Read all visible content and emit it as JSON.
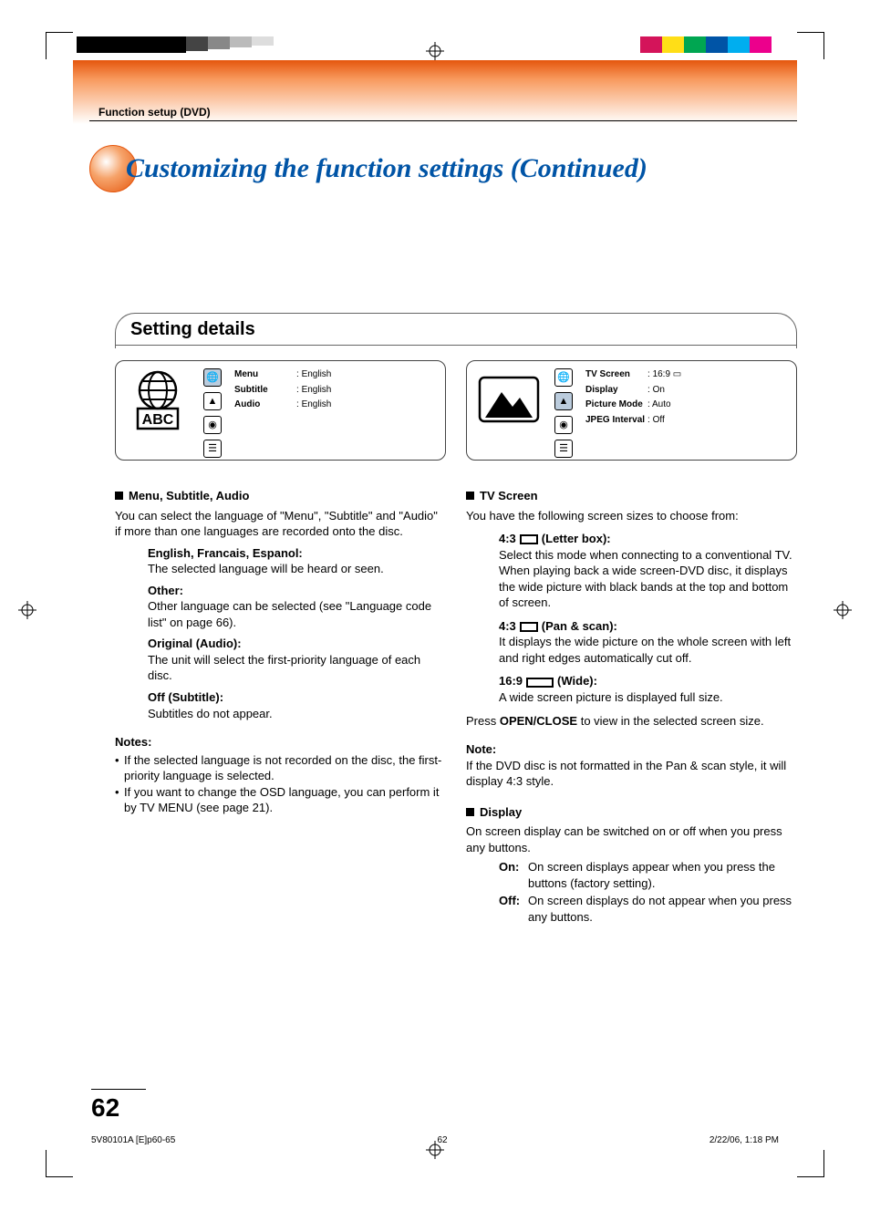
{
  "breadcrumb": "Function setup (DVD)",
  "title": "Customizing the function settings (Continued)",
  "section_title": "Setting details",
  "left_panel": {
    "rows": [
      {
        "k": "Menu",
        "v": "English"
      },
      {
        "k": "Subtitle",
        "v": "English"
      },
      {
        "k": "Audio",
        "v": "English"
      }
    ]
  },
  "right_panel": {
    "rows": [
      {
        "k": "TV Screen",
        "v": "16:9 ▭"
      },
      {
        "k": "Display",
        "v": "On"
      },
      {
        "k": "Picture Mode",
        "v": "Auto"
      },
      {
        "k": "JPEG Interval",
        "v": "Off"
      }
    ]
  },
  "left": {
    "head": "Menu, Subtitle, Audio",
    "intro": "You can select the language of \"Menu\", \"Subtitle\" and \"Audio\" if more than one languages are recorded onto the disc.",
    "items": [
      {
        "term": "English, Francais, Espanol:",
        "desc": "The selected language will be heard or seen."
      },
      {
        "term": "Other:",
        "desc": "Other language can be selected (see \"Language code list\" on page 66)."
      },
      {
        "term": "Original (Audio):",
        "desc": "The unit will select the first-priority language of each disc."
      },
      {
        "term": "Off (Subtitle):",
        "desc": "Subtitles do not appear."
      }
    ],
    "notes_head": "Notes:",
    "notes": [
      "If the selected language is not recorded on the disc, the first-priority language is selected.",
      "If you want to change the OSD language, you can perform it by TV MENU (see page 21)."
    ]
  },
  "right": {
    "head1": "TV Screen",
    "intro1": "You have the following screen sizes to choose from:",
    "ratios": [
      {
        "prefix": "4:3",
        "cls": "r43",
        "suffix": "(Letter box):",
        "desc": "Select this mode when connecting to a conventional TV. When playing back a wide screen-DVD disc, it displays the wide picture with black bands at the top and bottom of screen."
      },
      {
        "prefix": "4:3",
        "cls": "r43",
        "suffix": "(Pan & scan):",
        "desc": "It displays the wide picture on the whole screen with left and right edges automatically cut off."
      },
      {
        "prefix": "16:9",
        "cls": "r169",
        "suffix": "(Wide):",
        "desc": "A wide screen picture is displayed full size."
      }
    ],
    "press_line_a": "Press ",
    "press_bold": "OPEN/CLOSE",
    "press_line_b": " to view in the selected screen size.",
    "note_head": "Note:",
    "note_body": "If the DVD disc is not formatted in the Pan & scan style, it will display 4:3 style.",
    "head2": "Display",
    "intro2": "On screen display can be switched on or off when you press any buttons.",
    "onoff": [
      {
        "k": "On:",
        "v": "On screen displays appear when you press the buttons (factory setting)."
      },
      {
        "k": "Off:",
        "v": "On screen displays do not appear when you press any buttons."
      }
    ]
  },
  "page_number": "62",
  "footer": {
    "file": "5V80101A [E]p60-65",
    "page": "62",
    "date": "2/22/06, 1:18 PM"
  }
}
